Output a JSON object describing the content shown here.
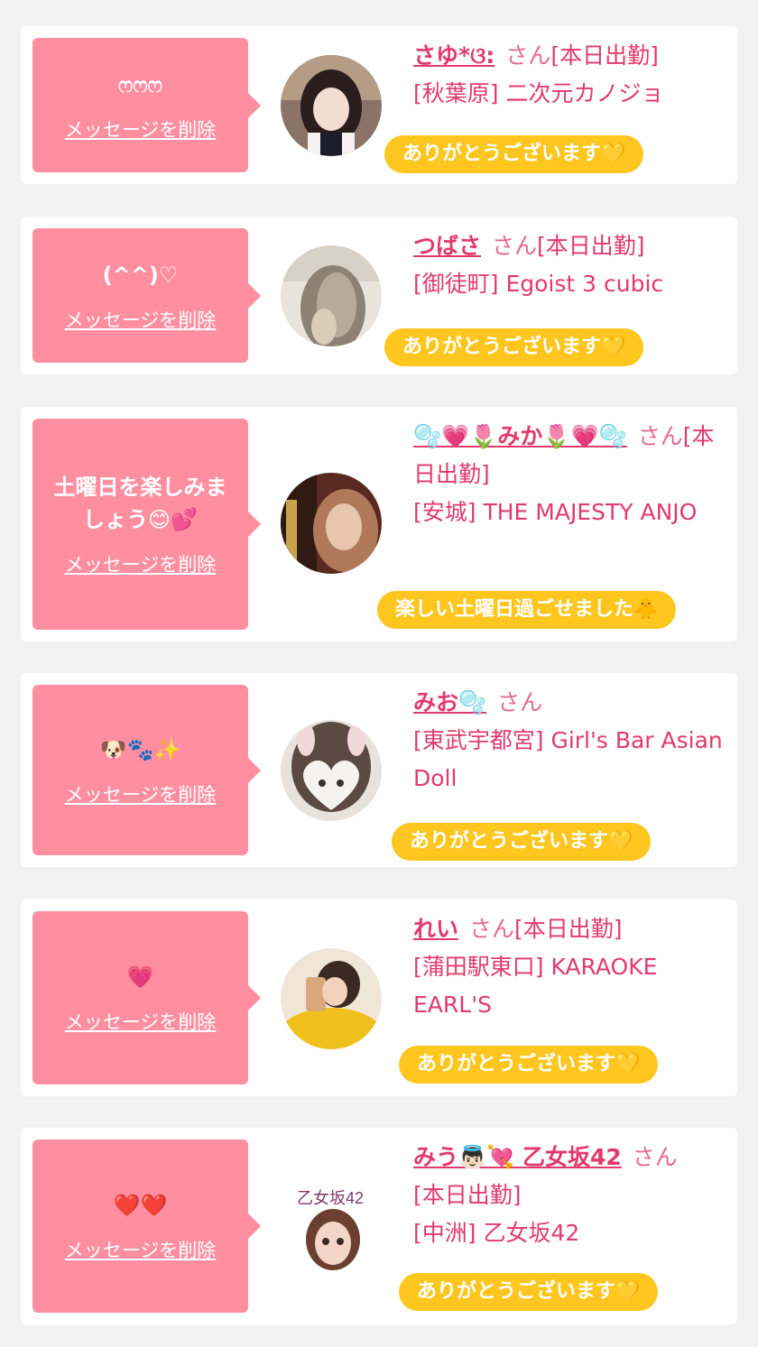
{
  "delete_label": "メッセージを削除",
  "san": "さん",
  "cards": [
    {
      "message": "ෆෆෆ",
      "nickname": "さゆ*ଓ:",
      "status": "[本日出勤]",
      "shop": "[秋葉原] 二次元カノジョ",
      "reply": "ありがとうございます💛"
    },
    {
      "message": "(^^)♡",
      "nickname": "つばさ",
      "status": "[本日出勤]",
      "shop": "[御徒町] Egoist 3 cubic",
      "reply": "ありがとうございます💛"
    },
    {
      "message": "土曜日を楽しみましょう😊💕",
      "nickname": "🫧💗🌷みか🌷💗🫧",
      "status": "[本日出勤]",
      "shop": "[安城] THE MAJESTY ANJO",
      "reply": "楽しい土曜日過ごせました🐥"
    },
    {
      "message": "🐶🐾✨",
      "nickname": "みお🫧",
      "status": "",
      "shop": "[東武宇都宮] Girl's Bar Asian Doll",
      "reply": "ありがとうございます💛"
    },
    {
      "message": "💗",
      "nickname": "れい",
      "status": "[本日出勤]",
      "shop": "[蒲田駅東口] KARAOKE EARL'S",
      "reply": "ありがとうございます💛"
    },
    {
      "message": "❤️❤️",
      "nickname": "みう👼🏻💘 乙女坂42",
      "status": "[本日出勤]",
      "shop": "[中洲] 乙女坂42",
      "reply": "ありがとうございます💛",
      "avatar_logo": "乙女坂42"
    }
  ],
  "colors": {
    "bubble": "#ff8fa0",
    "name": "#e23a6d",
    "reply_pill": "#ffc61f"
  }
}
